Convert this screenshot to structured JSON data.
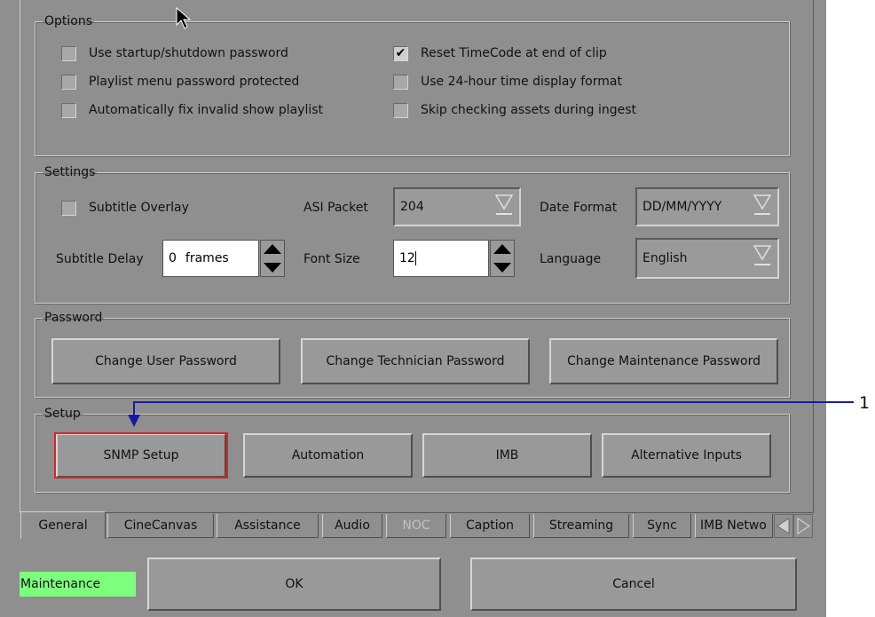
{
  "options": {
    "legend": "Options",
    "checkboxes": [
      {
        "label": "Use startup/shutdown password",
        "checked": false
      },
      {
        "label": "Playlist menu password protected",
        "checked": false
      },
      {
        "label": "Automatically fix invalid show playlist",
        "checked": false
      },
      {
        "label": "Reset TimeCode at end of clip",
        "checked": true
      },
      {
        "label": "Use 24-hour time display format",
        "checked": false
      },
      {
        "label": "Skip checking assets during ingest",
        "checked": false
      }
    ]
  },
  "settings": {
    "legend": "Settings",
    "subtitle_overlay": {
      "label": "Subtitle Overlay",
      "checked": false
    },
    "asi_packet": {
      "label": "ASI Packet",
      "value": "204"
    },
    "date_format": {
      "label": "Date Format",
      "value": "DD/MM/YYYY"
    },
    "subtitle_delay": {
      "label": "Subtitle Delay",
      "value": "0",
      "unit": "frames"
    },
    "font_size": {
      "label": "Font Size",
      "value": "12"
    },
    "language": {
      "label": "Language",
      "value": "English"
    }
  },
  "password": {
    "legend": "Password",
    "buttons": [
      "Change User Password",
      "Change Technician Password",
      "Change Maintenance Password"
    ]
  },
  "setup": {
    "legend": "Setup",
    "buttons": [
      "SNMP Setup",
      "Automation",
      "IMB",
      "Alternative Inputs"
    ]
  },
  "tabs": [
    {
      "label": "General",
      "active": true,
      "disabled": false
    },
    {
      "label": "CineCanvas",
      "active": false,
      "disabled": false
    },
    {
      "label": "Assistance",
      "active": false,
      "disabled": false
    },
    {
      "label": "Audio",
      "active": false,
      "disabled": false
    },
    {
      "label": "NOC",
      "active": false,
      "disabled": true
    },
    {
      "label": "Caption",
      "active": false,
      "disabled": false
    },
    {
      "label": "Streaming",
      "active": false,
      "disabled": false
    },
    {
      "label": "Sync",
      "active": false,
      "disabled": false
    },
    {
      "label": "IMB Netwo",
      "active": false,
      "disabled": false
    }
  ],
  "footer": {
    "mode_badge": "Maintenance",
    "ok_label": "OK",
    "cancel_label": "Cancel"
  },
  "callout": {
    "number": "1"
  },
  "colors": {
    "dialog_bg": "#8f8f8f",
    "badge_bg": "#7dff7d",
    "highlight_border": "#e02020",
    "callout_line": "#1a1aa0"
  }
}
